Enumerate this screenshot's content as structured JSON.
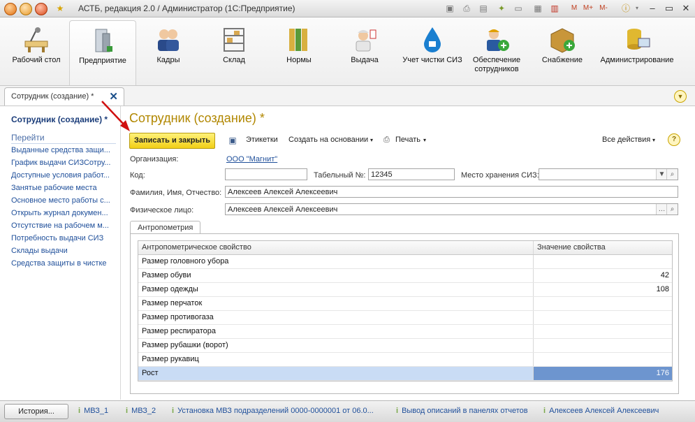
{
  "window": {
    "title": "АСТБ, редакция 2.0 / Администратор (1С:Предприятие)"
  },
  "sections": [
    {
      "label": "Рабочий стол",
      "icon": "desk-icon"
    },
    {
      "label": "Предприятие",
      "icon": "building-icon"
    },
    {
      "label": "Кадры",
      "icon": "people-icon"
    },
    {
      "label": "Склад",
      "icon": "warehouse-icon"
    },
    {
      "label": "Нормы",
      "icon": "binders-icon"
    },
    {
      "label": "Выдача",
      "icon": "worker-icon"
    },
    {
      "label": "Учет чистки СИЗ",
      "icon": "water-drop-icon"
    },
    {
      "label": "Обеспечение сотрудников",
      "icon": "worker-add-icon"
    },
    {
      "label": "Снабжение",
      "icon": "box-add-icon"
    },
    {
      "label": "Администрирование",
      "icon": "database-computer-icon"
    }
  ],
  "doc_tab": {
    "label": "Сотрудник (создание) *"
  },
  "left_panel": {
    "title": "Сотрудник (создание) *",
    "section": "Перейти",
    "items": [
      "Выданные средства защи...",
      "График выдачи СИЗСотру...",
      "Доступные условия работ...",
      "Занятые рабочие места",
      "Основное место работы с...",
      "Открыть журнал докумен...",
      "Отсутствие на рабочем м...",
      "Потребность выдачи СИЗ",
      "Склады выдачи",
      "Средства защиты в чистке"
    ]
  },
  "form": {
    "title": "Сотрудник (создание) *",
    "toolbar": {
      "save_close": "Записать и закрыть",
      "labels": "Этикетки",
      "create_based": "Создать на основании",
      "print": "Печать",
      "all_actions": "Все действия",
      "help": "?"
    },
    "organization_label": "Организация:",
    "organization_value": "ООО \"Магнит\"",
    "code_label": "Код:",
    "code_value": "",
    "tab_number_label": "Табельный №:",
    "tab_number_value": "12345",
    "storage_label": "Место хранения СИЗ:",
    "storage_value": "",
    "fullname_label": "Фамилия, Имя, Отчество:",
    "fullname_value": "Алексеев Алексей Алексеевич",
    "person_label": "Физическое лицо:",
    "person_value": "Алексеев Алексей Алексеевич",
    "panel_tab": "Антропометрия",
    "grid": {
      "headers": [
        "Антропометрическое свойство",
        "Значение свойства"
      ],
      "rows": [
        {
          "property": "Размер головного убора",
          "value": ""
        },
        {
          "property": "Размер обуви",
          "value": "42"
        },
        {
          "property": "Размер одежды",
          "value": "108"
        },
        {
          "property": "Размер перчаток",
          "value": ""
        },
        {
          "property": "Размер противогаза",
          "value": ""
        },
        {
          "property": "Размер респиратора",
          "value": ""
        },
        {
          "property": "Размер рубашки (ворот)",
          "value": ""
        },
        {
          "property": "Размер рукавиц",
          "value": ""
        },
        {
          "property": "Рост",
          "value": "176"
        }
      ]
    }
  },
  "statusbar": {
    "history_button": "История...",
    "items": [
      "МВЗ_1",
      "МВЗ_2",
      "Установка МВЗ подразделений 0000-0000001 от 06.0...",
      "Вывод описаний в панелях отчетов",
      "Алексеев Алексей Алексеевич"
    ]
  },
  "colors": {
    "accent_title": "#b18700",
    "primary_button": "#f2cf16",
    "link": "#1f4f9a",
    "selected_row": "#c9dcf5"
  }
}
